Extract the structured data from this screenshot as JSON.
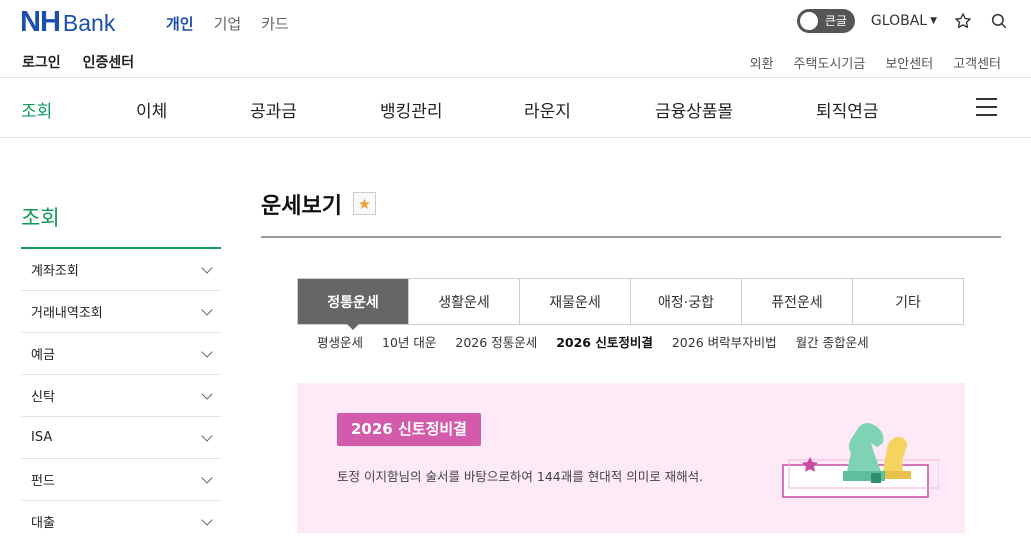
{
  "header": {
    "logo_nh": "NH",
    "logo_bank": "Bank",
    "segments": [
      "개인",
      "기업",
      "카드"
    ],
    "login": "로그인",
    "cert_center": "인증센터",
    "big_text_toggle": "큰글",
    "global": "GLOBAL",
    "utility_links": [
      "외환",
      "주택도시기금",
      "보안센터",
      "고객센터"
    ]
  },
  "nav": {
    "items": [
      "조회",
      "이체",
      "공과금",
      "뱅킹관리",
      "라운지",
      "금융상품몰",
      "퇴직연금"
    ]
  },
  "sidebar": {
    "title": "조회",
    "items": [
      "계좌조회",
      "거래내역조회",
      "예금",
      "신탁",
      "ISA",
      "펀드",
      "대출"
    ]
  },
  "main": {
    "title": "운세보기",
    "tabs": [
      "정통운세",
      "생활운세",
      "재물운세",
      "애정·궁합",
      "퓨전운세",
      "기타"
    ],
    "subtabs": [
      "평생운세",
      "10년 대운",
      "2026 정통운세",
      "2026 신토정비결",
      "2026 벼락부자비법",
      "월간 종합운세"
    ],
    "banner_title": "2026 신토정비결",
    "banner_desc": "토정 이지함님의 술서를 바탕으로하여 144괘를 현대적 의미로 재해석."
  },
  "colors": {
    "brand": "#1a4fb0",
    "accent_green": "#0e9a5a",
    "banner_bg": "#fdeaf6",
    "badge": "#d45bab"
  }
}
